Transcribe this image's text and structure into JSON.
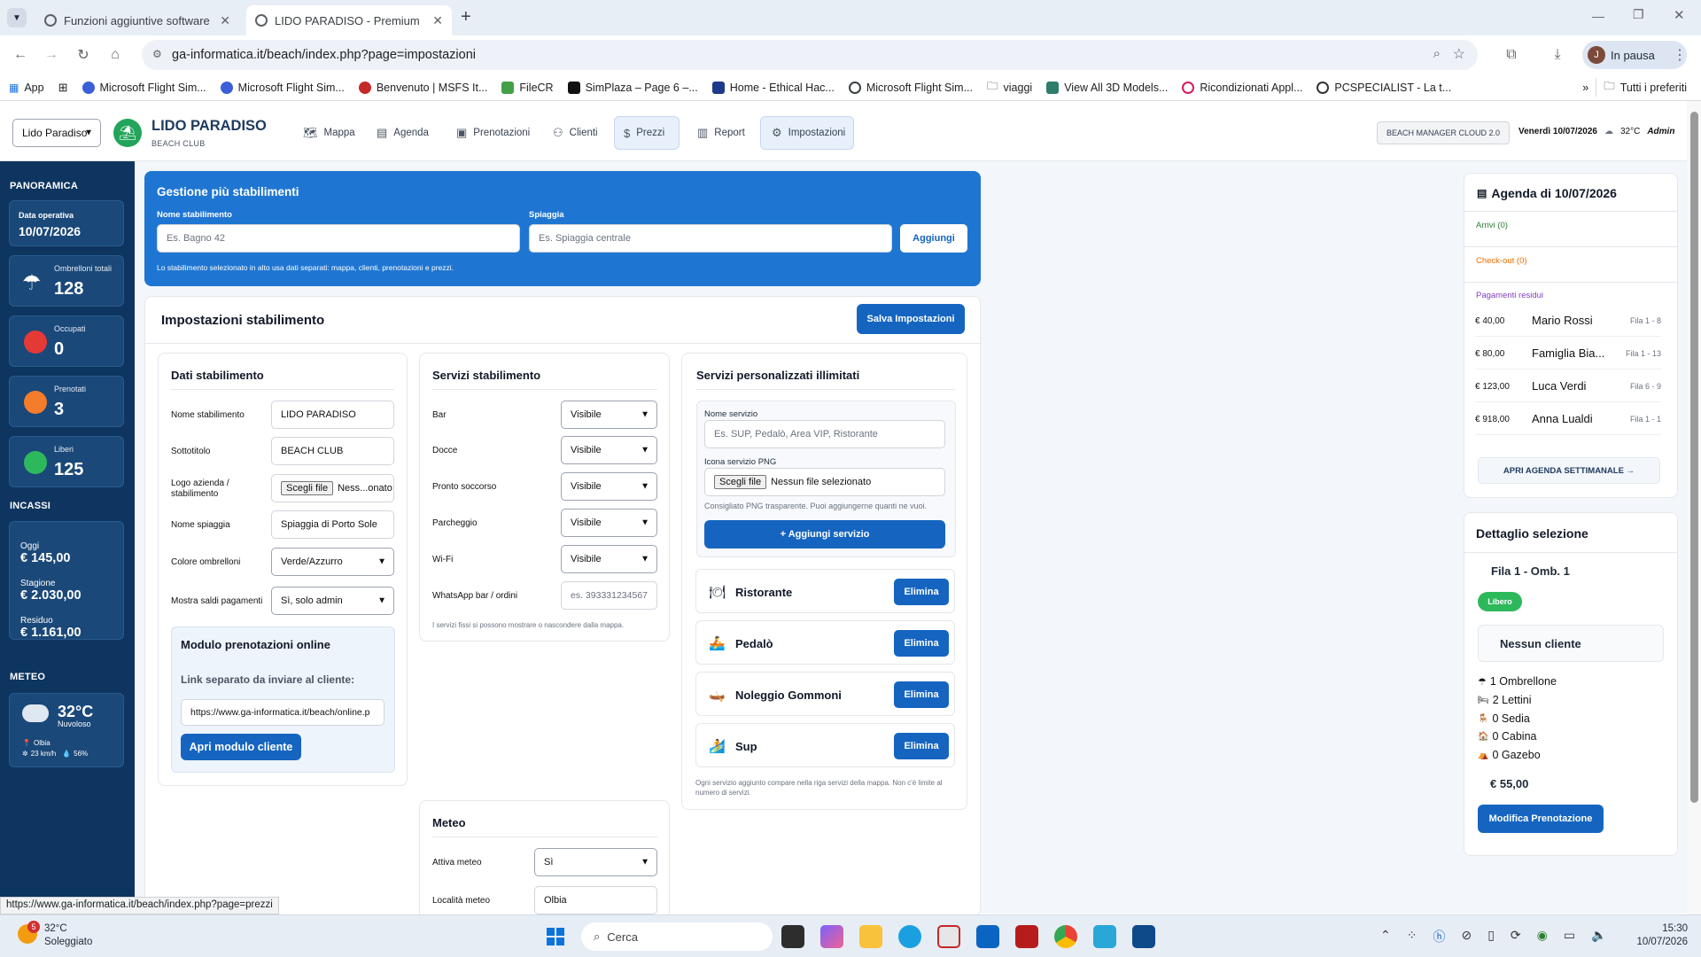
{
  "browser": {
    "tabs": [
      {
        "title": "Funzioni aggiuntive software"
      },
      {
        "title": "LIDO PARADISO - Premium"
      }
    ],
    "url": "ga-informatica.it/beach/index.php?page=impostazioni",
    "profile_initial": "J",
    "profile_label": "In pausa",
    "bookmarks": [
      "App",
      "Microsoft Flight Sim...",
      "Microsoft Flight Sim...",
      "Benvenuto | MSFS It...",
      "FileCR",
      "SimPlaza – Page 6 –...",
      "Home - Ethical Hac...",
      "Microsoft Flight Sim...",
      "viaggi",
      "View All 3D Models...",
      "Ricondizionati Appl...",
      "PCSPECIALIST - La t..."
    ],
    "all_bookmarks": "Tutti i preferiti",
    "status_url": "https://www.ga-informatica.it/beach/index.php?page=prezzi"
  },
  "header": {
    "location_select": "Lido Paradiso",
    "brand": "LIDO PARADISO",
    "brand_sub": "BEACH CLUB",
    "nav": [
      {
        "label": "Mappa",
        "icon": "map-icon"
      },
      {
        "label": "Agenda",
        "icon": "calendar-icon"
      },
      {
        "label": "Prenotazioni",
        "icon": "clipboard-icon"
      },
      {
        "label": "Clienti",
        "icon": "user-icon"
      },
      {
        "label": "Prezzi",
        "icon": "dollar-icon"
      },
      {
        "label": "Report",
        "icon": "chart-icon"
      },
      {
        "label": "Impostazioni",
        "icon": "gear-icon"
      }
    ],
    "version_pill": "BEACH MANAGER CLOUD 2.0",
    "date": "Venerdì 10/07/2026",
    "temp": "32°C",
    "user": "Admin"
  },
  "sidebar": {
    "panoramica_title": "PANORAMICA",
    "data_operativa_label": "Data operativa",
    "data_operativa": "10/07/2026",
    "stats": [
      {
        "label": "Ombrelloni totali",
        "value": "128",
        "color": ""
      },
      {
        "label": "Occupati",
        "value": "0",
        "color": "#e53935"
      },
      {
        "label": "Prenotati",
        "value": "3",
        "color": "#f57c2a"
      },
      {
        "label": "Liberi",
        "value": "125",
        "color": "#2eb85c"
      }
    ],
    "incassi_title": "INCASSI",
    "incassi": [
      {
        "label": "Oggi",
        "value": "€ 145,00"
      },
      {
        "label": "Stagione",
        "value": "€ 2.030,00"
      },
      {
        "label": "Residuo",
        "value": "€ 1.161,00"
      }
    ],
    "meteo_title": "METEO",
    "meteo_temp": "32°C",
    "meteo_desc": "Nuvoloso",
    "meteo_city": "Olbia",
    "meteo_wind": "23 km/h",
    "meteo_humidity": "56%"
  },
  "multi": {
    "title": "Gestione più stabilimenti",
    "name_label": "Nome stabilimento",
    "name_placeholder": "Es. Bagno 42",
    "beach_label": "Spiaggia",
    "beach_placeholder": "Es. Spiaggia centrale",
    "add_button": "Aggiungi",
    "note": "Lo stabilimento selezionato in alto usa dati separati: mappa, clienti, prenotazioni e prezzi."
  },
  "settings": {
    "title": "Impostazioni stabilimento",
    "save_button": "Salva Impostazioni",
    "dati": {
      "title": "Dati stabilimento",
      "fields": [
        {
          "label": "Nome stabilimento",
          "value": "LIDO PARADISO"
        },
        {
          "label": "Sottotitolo",
          "value": "BEACH CLUB"
        },
        {
          "label": "Logo azienda / stabilimento",
          "chooser": "Scegli file",
          "value": "Ness...onato"
        },
        {
          "label": "Nome spiaggia",
          "value": "Spiaggia di Porto Sole"
        },
        {
          "label": "Colore ombrelloni",
          "value": "Verde/Azzurro"
        },
        {
          "label": "Mostra saldi pagamenti",
          "value": "Sì, solo admin"
        }
      ],
      "online": {
        "title": "Modulo prenotazioni online",
        "sublabel": "Link separato da inviare al cliente:",
        "link": "https://www.ga-informatica.it/beach/online.p",
        "button": "Apri modulo cliente"
      }
    },
    "servizi": {
      "title": "Servizi stabilimento",
      "rows": [
        {
          "label": "Bar",
          "value": "Visibile"
        },
        {
          "label": "Docce",
          "value": "Visibile"
        },
        {
          "label": "Pronto soccorso",
          "value": "Visibile"
        },
        {
          "label": "Parcheggio",
          "value": "Visibile"
        },
        {
          "label": "Wi-Fi",
          "value": "Visibile"
        },
        {
          "label": "WhatsApp bar / ordini",
          "placeholder": "es. 393331234567"
        }
      ],
      "note": "I servizi fissi si possono mostrare o nascondere dalla mappa."
    },
    "custom": {
      "title": "Servizi personalizzati illimitati",
      "name_label": "Nome servizio",
      "name_placeholder": "Es. SUP, Pedalò, Area VIP, Ristorante",
      "icon_label": "Icona servizio PNG",
      "chooser": "Scegli file",
      "no_file": "Nessun file selezionato",
      "hint": "Consigliato PNG trasparente. Puoi aggiungerne quanti ne vuoi.",
      "add_button": "+ Aggiungi servizio",
      "services": [
        {
          "name": "Ristorante",
          "icon": "plate-icon",
          "glyph": "🍽"
        },
        {
          "name": "Pedalò",
          "icon": "pedalo-icon",
          "glyph": "🚣"
        },
        {
          "name": "Noleggio Gommoni",
          "icon": "dinghy-icon",
          "glyph": "🛶"
        },
        {
          "name": "Sup",
          "icon": "sup-icon",
          "glyph": "🏄"
        }
      ],
      "delete_label": "Elimina",
      "footer": "Ogni servizio aggiunto compare nella riga servizi della mappa. Non c'è limite al numero di servizi."
    },
    "meteo": {
      "title": "Meteo",
      "attiva_label": "Attiva meteo",
      "attiva_value": "Sì",
      "localita_label": "Località meteo",
      "localita_value": "Olbia"
    }
  },
  "agenda": {
    "title": "Agenda di 10/07/2026",
    "arrivi": "Arrivi (0)",
    "checkout": "Check-out (0)",
    "pagamenti_title": "Pagamenti residui",
    "pagamenti": [
      {
        "amount": "€ 40,00",
        "name": "Mario Rossi",
        "fila": "Fila 1 - 8"
      },
      {
        "amount": "€ 80,00",
        "name": "Famiglia Bia...",
        "fila": "Fila 1 - 13"
      },
      {
        "amount": "€ 123,00",
        "name": "Luca Verdi",
        "fila": "Fila 6 - 9"
      },
      {
        "amount": "€ 918,00",
        "name": "Anna Lualdi",
        "fila": "Fila 1 - 1"
      }
    ],
    "weekly_button": "APRI AGENDA SETTIMANALE →"
  },
  "detail": {
    "title": "Dettaglio selezione",
    "spot": "Fila 1 - Omb. 1",
    "badge": "Libero",
    "client": "Nessun cliente",
    "equipment": [
      {
        "text": "1 Ombrellone",
        "icon": "umbrella-icon",
        "glyph": "☂"
      },
      {
        "text": "2 Lettini",
        "icon": "sunbed-icon",
        "glyph": "🛏"
      },
      {
        "text": "0 Sedia",
        "icon": "chair-icon",
        "glyph": "🪑"
      },
      {
        "text": "0 Cabina",
        "icon": "cabin-icon",
        "glyph": "🏠"
      },
      {
        "text": "0 Gazebo",
        "icon": "gazebo-icon",
        "glyph": "⛺"
      }
    ],
    "price": "€ 55,00",
    "edit_button": "Modifica Prenotazione"
  },
  "taskbar": {
    "weather_temp": "32°C",
    "weather_desc": "Soleggiato",
    "badge": "5",
    "search_placeholder": "Cerca",
    "time": "15:30",
    "date": "10/07/2026"
  },
  "colors": {
    "primary": "#1565c0",
    "sidebar": "#0e355f",
    "badge_free": "#2eb85c"
  }
}
